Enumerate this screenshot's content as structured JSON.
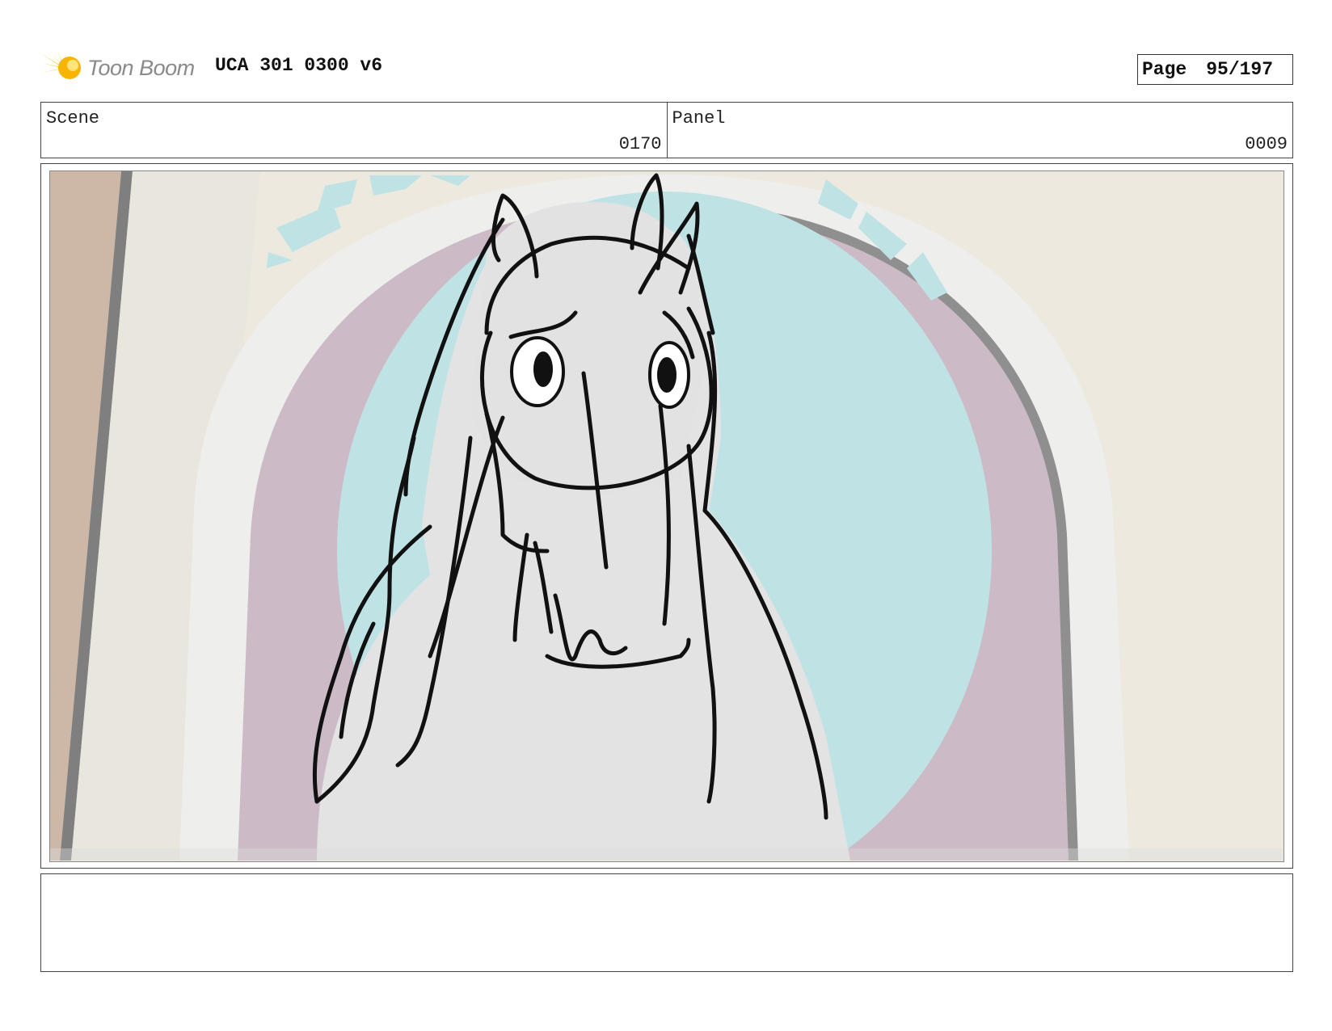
{
  "header": {
    "logo_text": "Toon Boom",
    "title": "UCA 301 0300 v6",
    "page_label": "Page",
    "page_number": "95/197"
  },
  "info": {
    "scene_label": "Scene",
    "scene_value": "0170",
    "panel_label": "Panel",
    "panel_value": "0009"
  },
  "notes": {
    "text": ""
  }
}
